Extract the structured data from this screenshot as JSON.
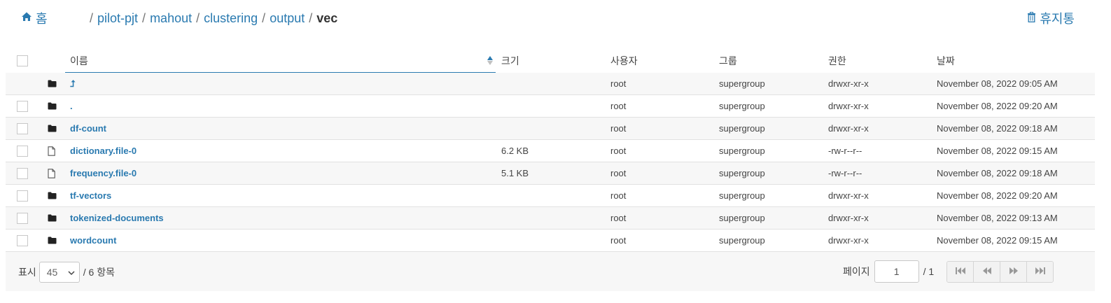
{
  "breadcrumb": {
    "home_label": "홈",
    "items": [
      "pilot-pjt",
      "mahout",
      "clustering",
      "output",
      "vec"
    ]
  },
  "trash_label": "휴지통",
  "columns": {
    "name": "이름",
    "size": "크기",
    "user": "사용자",
    "group": "그룹",
    "permission": "권한",
    "date": "날짜"
  },
  "rows": [
    {
      "icon": "folder-icon",
      "name": "⮥",
      "size": "",
      "user": "root",
      "group": "supergroup",
      "permission": "drwxr-xr-x",
      "date": "November 08, 2022 09:05 AM"
    },
    {
      "icon": "folder-icon",
      "name": ".",
      "size": "",
      "user": "root",
      "group": "supergroup",
      "permission": "drwxr-xr-x",
      "date": "November 08, 2022 09:20 AM"
    },
    {
      "icon": "folder-icon",
      "name": "df-count",
      "size": "",
      "user": "root",
      "group": "supergroup",
      "permission": "drwxr-xr-x",
      "date": "November 08, 2022 09:18 AM"
    },
    {
      "icon": "file-icon",
      "name": "dictionary.file-0",
      "size": "6.2 KB",
      "user": "root",
      "group": "supergroup",
      "permission": "-rw-r--r--",
      "date": "November 08, 2022 09:15 AM"
    },
    {
      "icon": "file-icon",
      "name": "frequency.file-0",
      "size": "5.1 KB",
      "user": "root",
      "group": "supergroup",
      "permission": "-rw-r--r--",
      "date": "November 08, 2022 09:18 AM"
    },
    {
      "icon": "folder-icon",
      "name": "tf-vectors",
      "size": "",
      "user": "root",
      "group": "supergroup",
      "permission": "drwxr-xr-x",
      "date": "November 08, 2022 09:20 AM"
    },
    {
      "icon": "folder-icon",
      "name": "tokenized-documents",
      "size": "",
      "user": "root",
      "group": "supergroup",
      "permission": "drwxr-xr-x",
      "date": "November 08, 2022 09:13 AM"
    },
    {
      "icon": "folder-icon",
      "name": "wordcount",
      "size": "",
      "user": "root",
      "group": "supergroup",
      "permission": "drwxr-xr-x",
      "date": "November 08, 2022 09:15 AM"
    }
  ],
  "footer": {
    "show_label": "표시",
    "page_size": "45",
    "items_label": "/ 6 항목",
    "page_label": "페이지",
    "page_value": "1",
    "page_total": "/ 1"
  },
  "colors": {
    "link": "#2a7ab0",
    "stripe": "#f7f7f7",
    "border": "#e1e1e1"
  }
}
